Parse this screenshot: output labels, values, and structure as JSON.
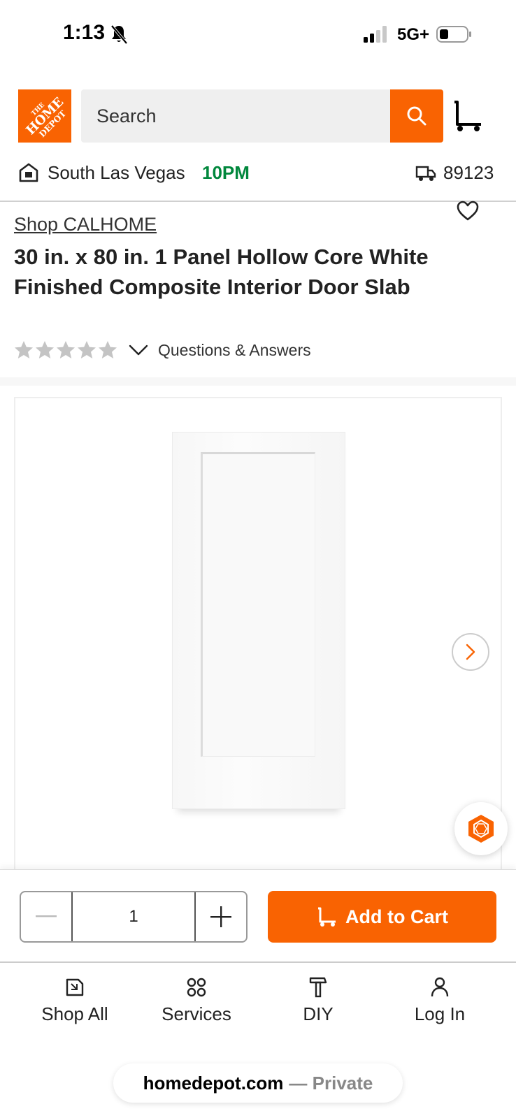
{
  "status_bar": {
    "time": "1:13",
    "network": "5G+"
  },
  "header": {
    "logo_text": [
      "THE",
      "HOME",
      "DEPOT"
    ],
    "search_placeholder": "Search"
  },
  "store": {
    "name": "South Las Vegas",
    "closing_time": "10PM",
    "zip": "89123"
  },
  "product": {
    "brand_link": "Shop CALHOME",
    "title": "30 in. x 80 in. 1 Panel Hollow Core White Finished Composite Interior Door Slab",
    "rating_stars": 0,
    "qa_label": "Questions & Answers"
  },
  "cart_bar": {
    "quantity": "1",
    "add_label": "Add to Cart"
  },
  "nav": {
    "items": [
      {
        "label": "Shop All",
        "icon": "shop-all-icon"
      },
      {
        "label": "Services",
        "icon": "services-icon"
      },
      {
        "label": "DIY",
        "icon": "hammer-icon"
      },
      {
        "label": "Log In",
        "icon": "user-icon"
      }
    ]
  },
  "url_bar": {
    "domain": "homedepot.com",
    "separator": "—",
    "mode": "Private"
  },
  "colors": {
    "brand_orange": "#f96302",
    "store_green": "#00873c"
  }
}
